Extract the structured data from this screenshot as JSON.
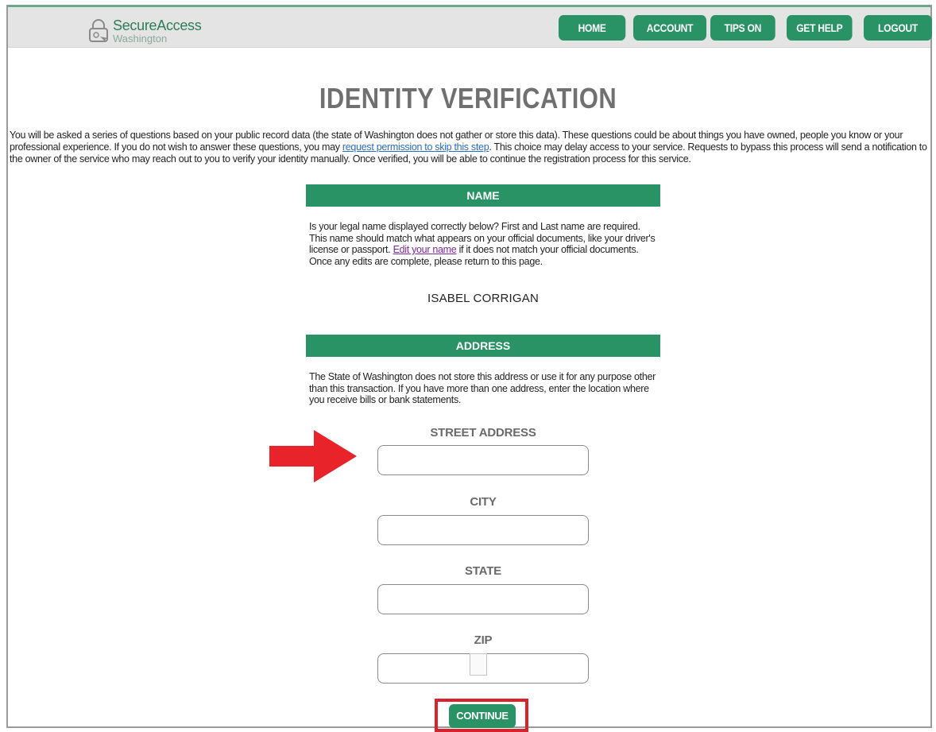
{
  "brand": {
    "main": "SecureAccess",
    "sub": "Washington"
  },
  "nav": [
    {
      "label": "HOME"
    },
    {
      "label": "ACCOUNT"
    },
    {
      "label": "TIPS ON"
    },
    {
      "label": "GET HELP"
    },
    {
      "label": "LOGOUT"
    }
  ],
  "page": {
    "title": "IDENTITY VERIFICATION",
    "intro_before": "You will be asked a series of questions based on your public record data (the state of Washington does not gather or store this data). These questions could be about things you have owned, people you know or your professional experience. If you do not wish to answer these questions, you may ",
    "intro_link": "request permission to skip this step",
    "intro_after": ". This choice may delay access to your service. Requests to bypass this process will send a notification to the owner of the service who may reach out to you to verify your identity manually. Once verified, you will be able to continue the registration process for this service."
  },
  "name_section": {
    "header": "NAME",
    "text_before": "Is your legal name displayed correctly below? First and Last name are required. This name should match what appears on your official documents, like your driver's license or passport. ",
    "edit_link": "Edit your name",
    "text_after": " if it does not match your official documents. Once any edits are complete, please return to this page.",
    "value": "ISABEL CORRIGAN"
  },
  "address_section": {
    "header": "ADDRESS",
    "text": "The State of Washington does not store this address or use it for any purpose other than this transaction. If you have more than one address, enter the location where you receive bills or bank statements.",
    "fields": {
      "street": {
        "label": "STREET ADDRESS",
        "value": ""
      },
      "city": {
        "label": "CITY",
        "value": ""
      },
      "state": {
        "label": "STATE",
        "value": ""
      },
      "zip": {
        "label": "ZIP",
        "value": ""
      }
    }
  },
  "continue_label": "CONTINUE",
  "colors": {
    "brand_green": "#2a9365",
    "highlight_red": "#d9222a",
    "title_gray": "#707070"
  },
  "icons": {
    "logo": "padlock-icon",
    "pointer": "red-arrow-icon"
  }
}
